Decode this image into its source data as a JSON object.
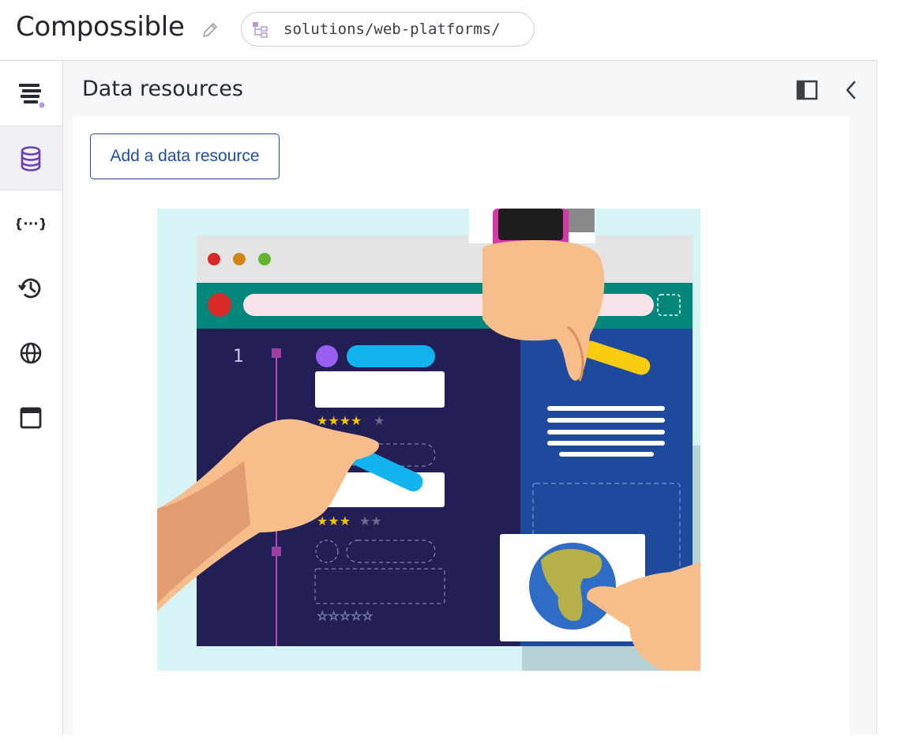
{
  "header": {
    "app_title": "Compossible",
    "path": "solutions/web-platforms/"
  },
  "rail": {
    "items": [
      {
        "icon": "menu-icon",
        "active": false
      },
      {
        "icon": "database-icon",
        "active": true
      },
      {
        "icon": "variables-braces-icon",
        "active": false
      },
      {
        "icon": "history-icon",
        "active": false
      },
      {
        "icon": "globe-icon",
        "active": false
      },
      {
        "icon": "window-icon",
        "active": false
      }
    ]
  },
  "panel": {
    "title": "Data resources",
    "add_button_label": "Add a data resource",
    "illustration": {
      "line_number": "1",
      "subject": "hands interacting with a web page builder"
    }
  },
  "colors": {
    "accent_purple": "#6c3fb5",
    "button_blue": "#1d4fa8"
  }
}
